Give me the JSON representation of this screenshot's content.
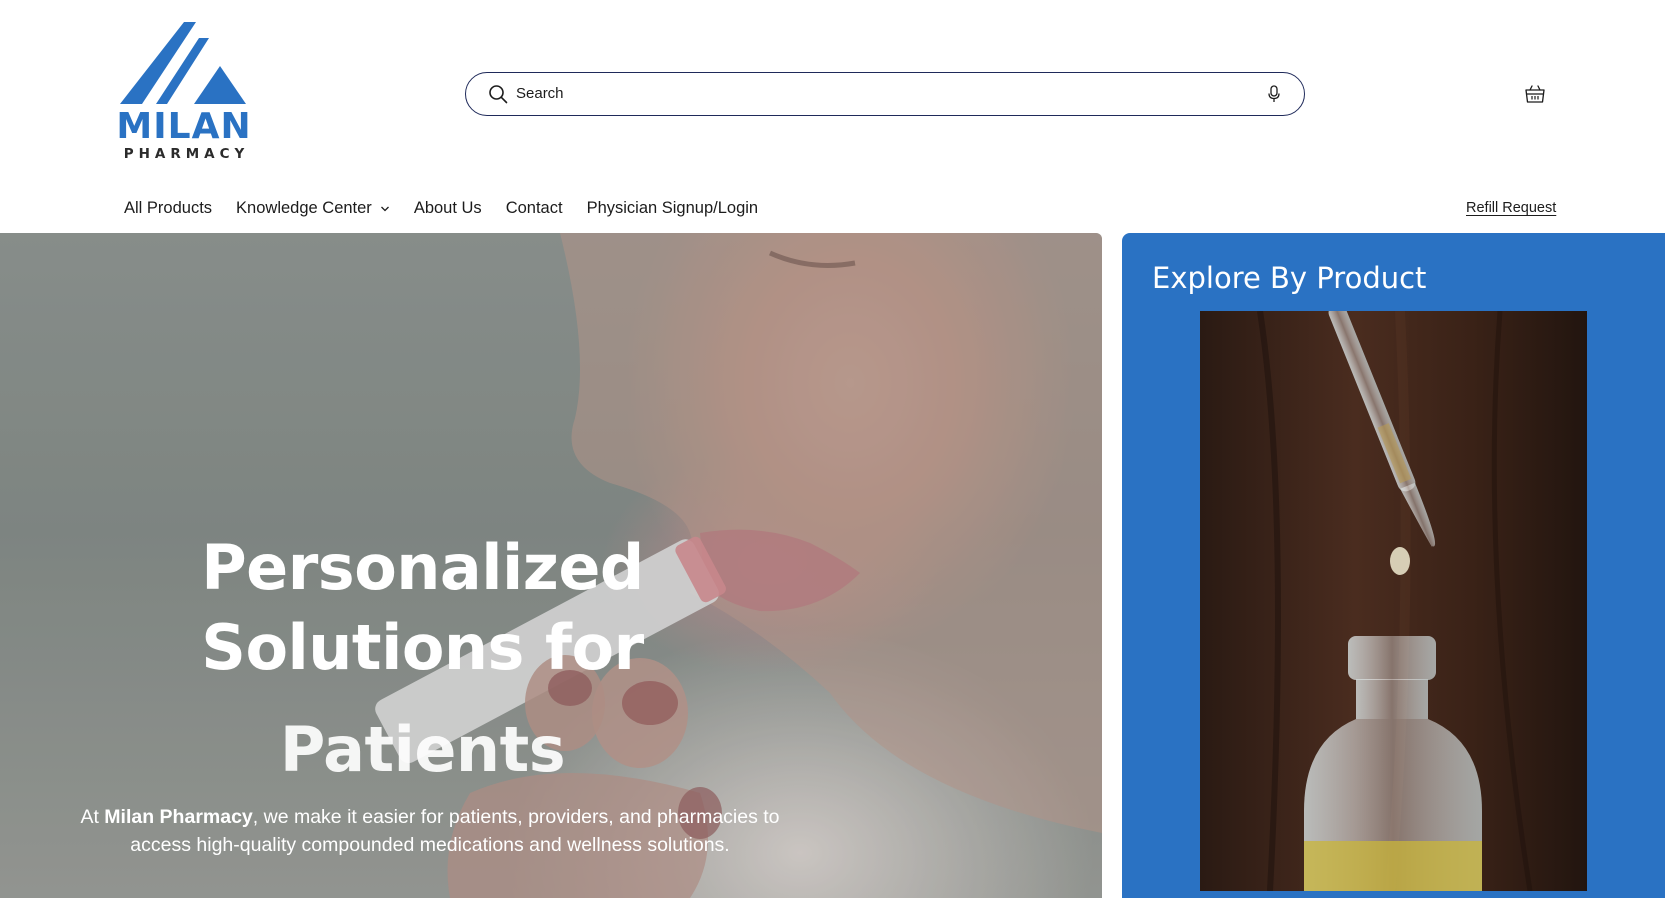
{
  "header": {
    "logo": {
      "brand": "MILAN",
      "sub": "PHARMACY",
      "color": "#2a72c3"
    },
    "search": {
      "placeholder": "Search",
      "value": ""
    },
    "icons": {
      "search": "search-icon",
      "mic": "microphone-icon",
      "cart": "cart-icon"
    }
  },
  "nav": {
    "items": [
      {
        "label": "All Products"
      },
      {
        "label": "Knowledge Center",
        "has_dropdown": true
      },
      {
        "label": "About Us"
      },
      {
        "label": "Contact"
      },
      {
        "label": "Physician Signup/Login"
      }
    ],
    "refill_label": "Refill Request"
  },
  "hero": {
    "title_line1": "Personalized",
    "title_line2": "Solutions for",
    "title_line3": "Patients",
    "copy_prefix": "At ",
    "copy_brand": "Milan Pharmacy",
    "copy_line1_rest": ", we make it easier for patients, providers, and pharmacies to",
    "copy_line2": "access high-quality compounded medications and wellness solutions."
  },
  "explore": {
    "title": "Explore By Product",
    "panel_color": "#2a72c3"
  }
}
